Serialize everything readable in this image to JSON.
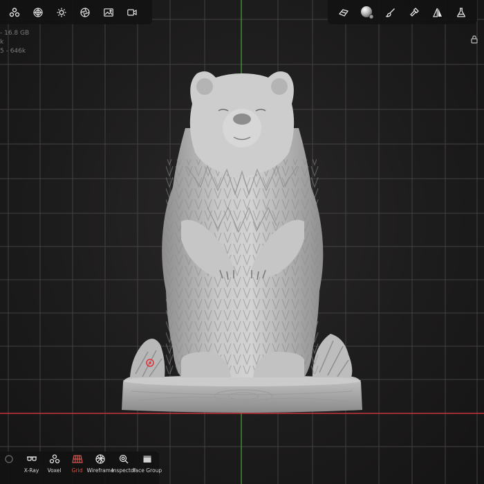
{
  "app": {
    "accent_color": "#d0574d",
    "axis_x_color": "#c8343c",
    "axis_y_color": "#4aa83c"
  },
  "top_left_toolbar": {
    "icons": [
      "scene-icon",
      "material-sphere-icon",
      "lighting-icon",
      "camera-aperture-icon",
      "image-icon",
      "video-camera-icon"
    ]
  },
  "top_right_toolbar": {
    "icons": [
      "stroke-brush-icon",
      "matcap-sphere-icon",
      "paint-brush-icon",
      "flashlight-icon",
      "symmetry-icon",
      "flask-icon"
    ]
  },
  "stats": {
    "line1": "- 16.8 GB",
    "line2": "k",
    "line3": "5 - 646k"
  },
  "bottom_toolbar": {
    "items": [
      {
        "label": "",
        "icon": "partial-icon"
      },
      {
        "label": "X-Ray",
        "icon": "xray-glasses-icon"
      },
      {
        "label": "Voxel",
        "icon": "voxel-icon"
      },
      {
        "label": "Grid",
        "icon": "grid-icon",
        "active": true
      },
      {
        "label": "Wireframe",
        "icon": "wireframe-icon"
      },
      {
        "label": "Inspector",
        "icon": "inspector-icon"
      },
      {
        "label": "Face Group",
        "icon": "face-group-icon"
      }
    ]
  }
}
